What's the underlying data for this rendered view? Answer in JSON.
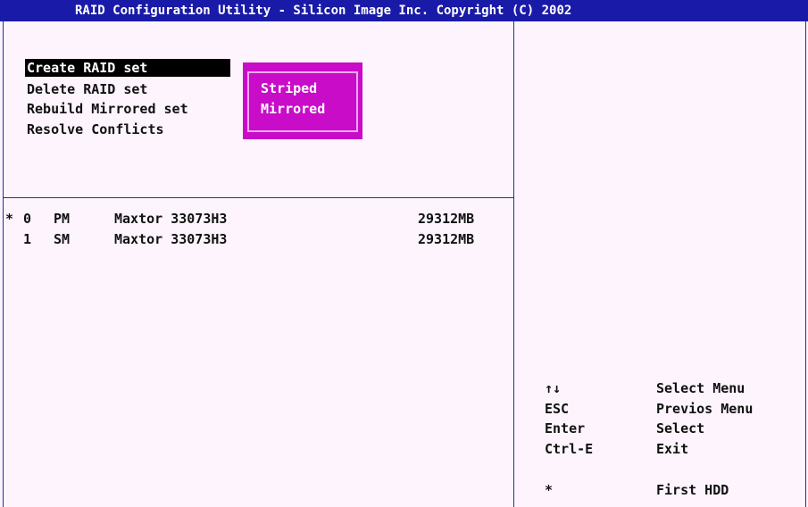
{
  "title": "RAID Configuration Utility - Silicon Image Inc. Copyright (C) 2002",
  "main_menu": [
    {
      "label": "Create RAID set",
      "selected": true
    },
    {
      "label": "Delete RAID set",
      "selected": false
    },
    {
      "label": "Rebuild Mirrored set",
      "selected": false
    },
    {
      "label": "Resolve Conflicts",
      "selected": false
    }
  ],
  "submenu": [
    {
      "label": "Striped"
    },
    {
      "label": "Mirrored"
    }
  ],
  "drives": [
    {
      "marker": "*",
      "num": "0",
      "type": "PM",
      "model": "Maxtor 33073H3",
      "size": "29312MB"
    },
    {
      "marker": "",
      "num": "1",
      "type": "SM",
      "model": "Maxtor 33073H3",
      "size": "29312MB"
    }
  ],
  "help": [
    {
      "key": "↑↓",
      "desc": "Select Menu"
    },
    {
      "key": "ESC",
      "desc": "Previos Menu"
    },
    {
      "key": "Enter",
      "desc": "Select"
    },
    {
      "key": "Ctrl-E",
      "desc": "Exit"
    },
    {
      "key": "*",
      "desc": "First HDD"
    }
  ],
  "colors": {
    "title_bg": "#1a1aa8",
    "background": "#fdf4fd",
    "popup_bg": "#c80cc8",
    "selected_bg": "#000000"
  }
}
